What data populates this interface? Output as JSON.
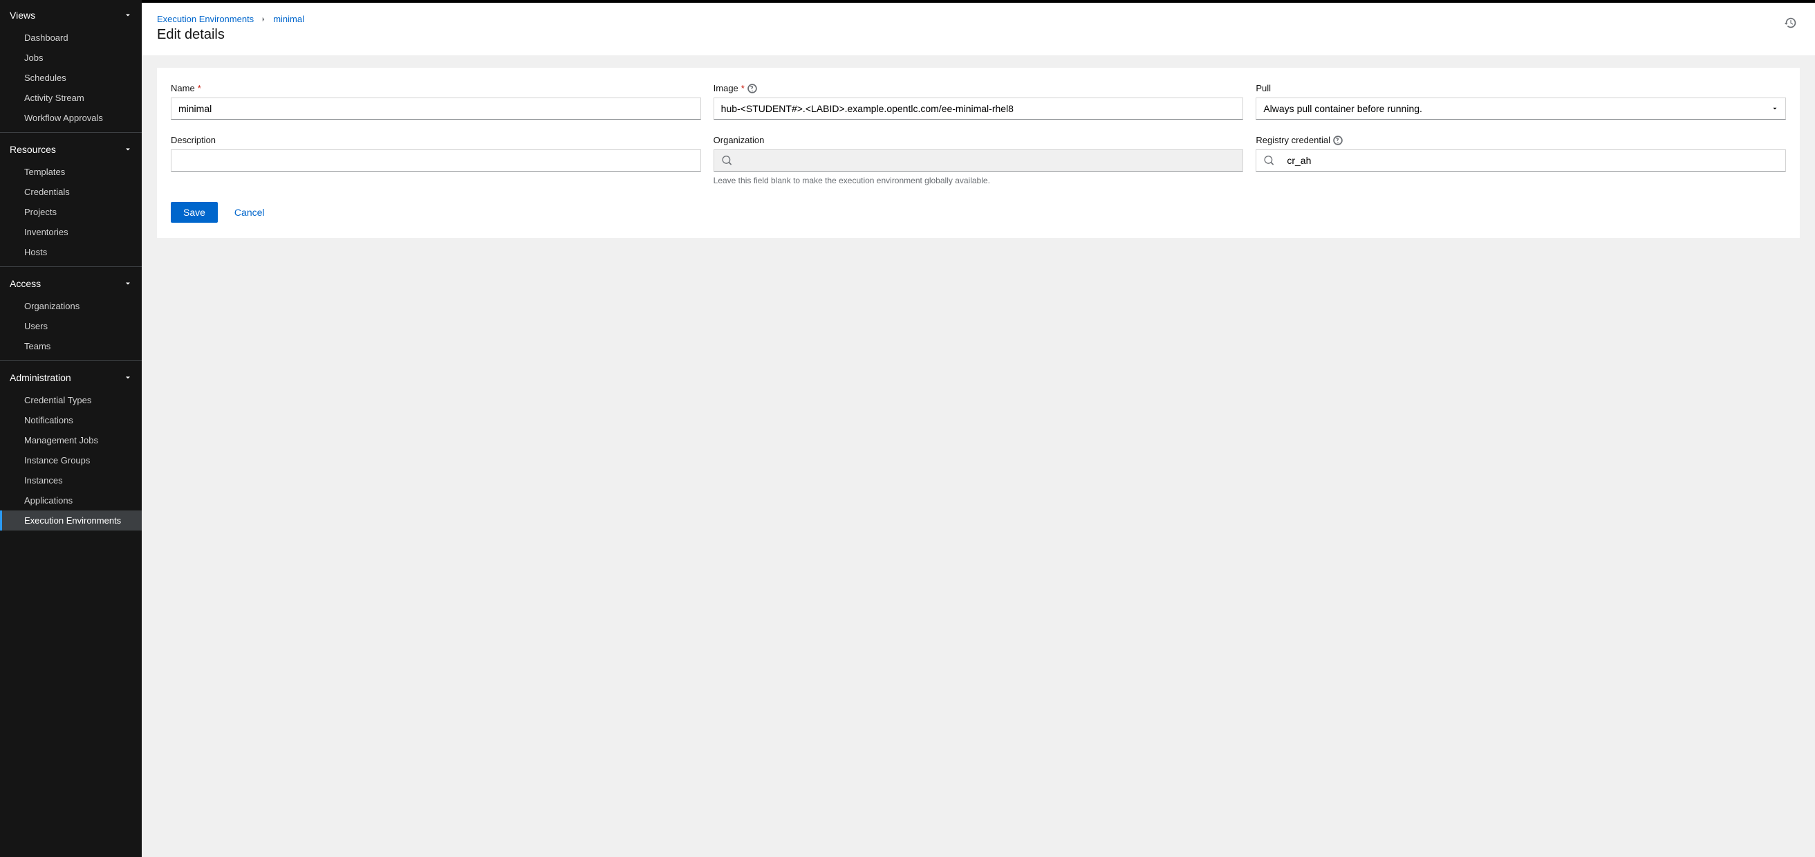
{
  "sidebar": {
    "sections": [
      {
        "title": "Views",
        "items": [
          "Dashboard",
          "Jobs",
          "Schedules",
          "Activity Stream",
          "Workflow Approvals"
        ]
      },
      {
        "title": "Resources",
        "items": [
          "Templates",
          "Credentials",
          "Projects",
          "Inventories",
          "Hosts"
        ]
      },
      {
        "title": "Access",
        "items": [
          "Organizations",
          "Users",
          "Teams"
        ]
      },
      {
        "title": "Administration",
        "items": [
          "Credential Types",
          "Notifications",
          "Management Jobs",
          "Instance Groups",
          "Instances",
          "Applications",
          "Execution Environments"
        ]
      }
    ],
    "active_item": "Execution Environments"
  },
  "breadcrumbs": {
    "parent": "Execution Environments",
    "current": "minimal"
  },
  "page": {
    "title": "Edit details"
  },
  "form": {
    "name": {
      "label": "Name",
      "value": "minimal",
      "required": true
    },
    "image": {
      "label": "Image",
      "value": "hub-<STUDENT#>.<LABID>.example.opentlc.com/ee-minimal-rhel8",
      "required": true
    },
    "pull": {
      "label": "Pull",
      "value": "Always pull container before running."
    },
    "description": {
      "label": "Description",
      "value": ""
    },
    "organization": {
      "label": "Organization",
      "value": "",
      "hint": "Leave this field blank to make the execution environment globally available."
    },
    "registry_credential": {
      "label": "Registry credential",
      "value": "cr_ah"
    }
  },
  "actions": {
    "save": "Save",
    "cancel": "Cancel"
  }
}
